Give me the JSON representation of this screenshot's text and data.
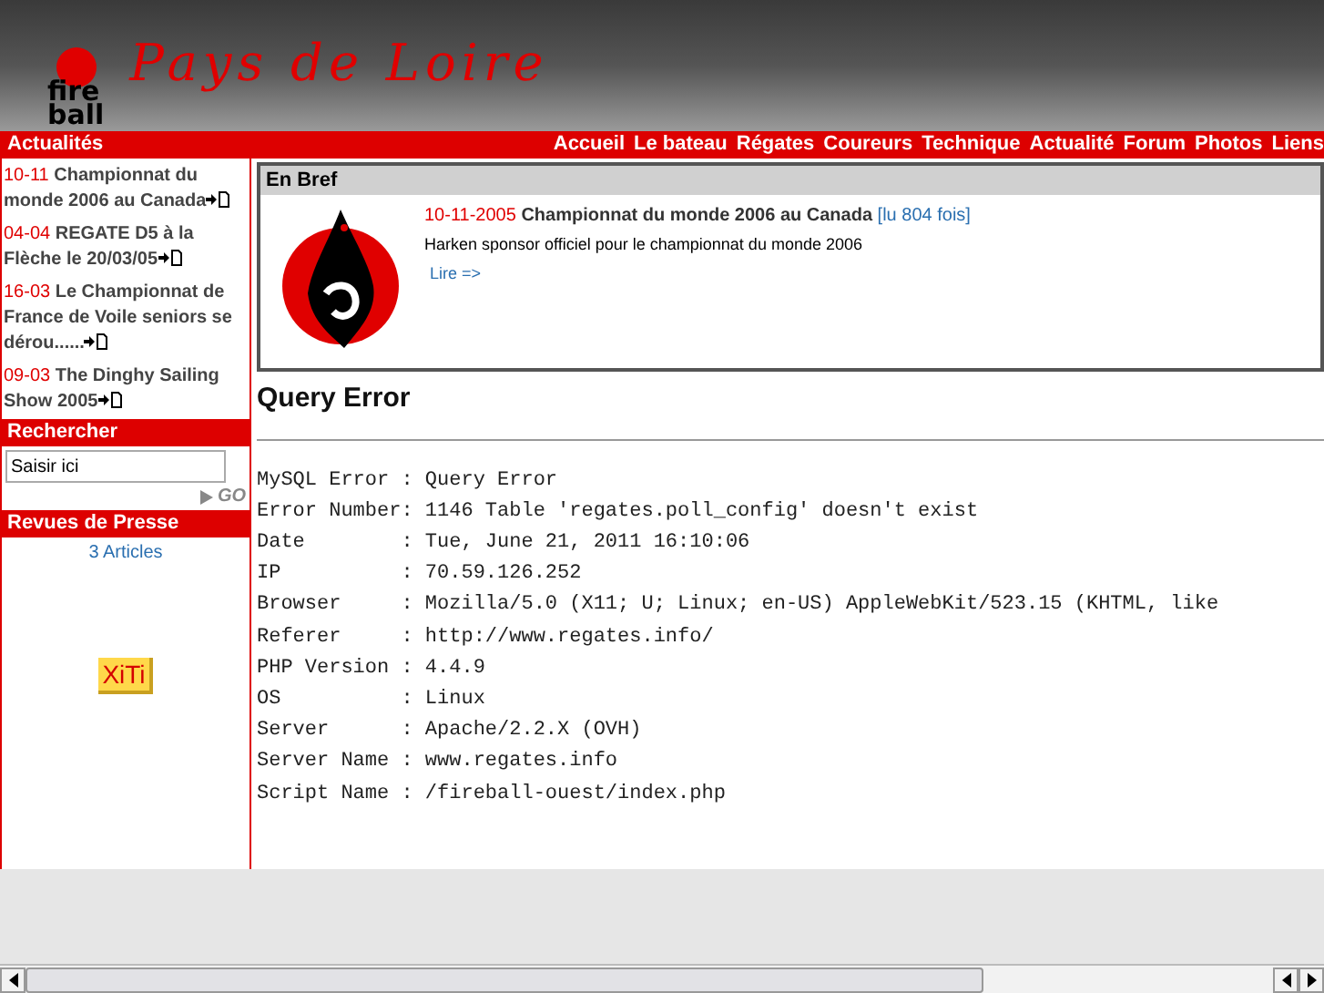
{
  "banner": {
    "logo_lines": [
      "fire",
      "ball"
    ],
    "title": "Pays de Loire"
  },
  "topbar": {
    "section": "Actualités",
    "nav": [
      "Accueil",
      "Le bateau",
      "Régates",
      "Coureurs",
      "Technique",
      "Actualité",
      "Forum",
      "Photos",
      "Liens"
    ]
  },
  "news": [
    {
      "date": "10-11",
      "title": "Championnat du monde 2006 au Canada"
    },
    {
      "date": "04-04",
      "title": "REGATE D5 à la Flèche le 20/03/05"
    },
    {
      "date": "16-03",
      "title": "Le Championnat de France de Voile seniors se dérou......"
    },
    {
      "date": "09-03",
      "title": "The Dinghy Sailing Show 2005"
    }
  ],
  "search": {
    "heading": "Rechercher",
    "value": "Saisir ici",
    "go": "GO"
  },
  "press": {
    "heading": "Revues de Presse",
    "link": "3 Articles"
  },
  "badge": "XiTi",
  "brief": {
    "heading": "En Bref",
    "date": "10-11-2005",
    "title": "Championnat du monde 2006 au Canada",
    "reads": "[lu 804 fois]",
    "text": "Harken sponsor officiel pour le championnat du monde 2006",
    "more": "Lire =>"
  },
  "error": {
    "title": "Query Error",
    "lines": [
      "MySQL Error : Query Error",
      "Error Number: 1146 Table 'regates.poll_config' doesn't exist",
      "Date        : Tue, June 21, 2011 16:10:06",
      "IP          : 70.59.126.252",
      "Browser     : Mozilla/5.0 (X11; U; Linux; en-US) AppleWebKit/523.15 (KHTML, like",
      "Referer     : http://www.regates.info/",
      "PHP Version : 4.4.9",
      "OS          : Linux",
      "Server      : Apache/2.2.X (OVH)",
      "Server Name : www.regates.info",
      "Script Name : /fireball-ouest/index.php"
    ]
  }
}
